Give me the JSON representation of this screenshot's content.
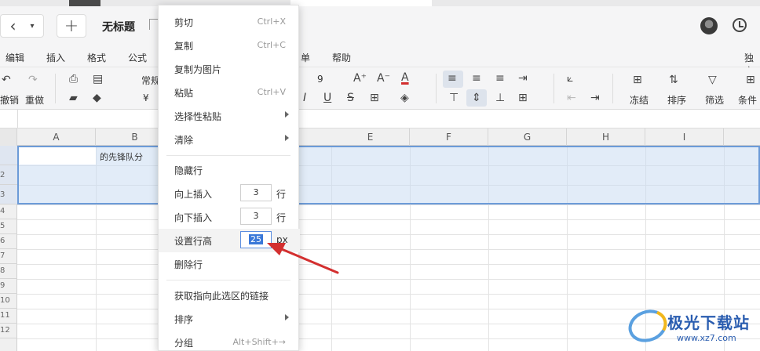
{
  "title_bar": {
    "doc_title": "无标题",
    "back_glyph": "‹",
    "dropdown_glyph": "▾",
    "add_glyph": "+"
  },
  "menu_bar": {
    "items": [
      "编辑",
      "插入",
      "格式",
      "公式",
      "单",
      "帮助"
    ],
    "right_item": "独立"
  },
  "toolbar": {
    "undo_label": "撤销",
    "redo_label": "重做",
    "number_format": "常规",
    "currency_glyph": "¥",
    "font_size": "9",
    "bold_glyph": "A⁺",
    "shrink_glyph": "A⁻",
    "font_color_glyph": "A",
    "italic_glyph": "I",
    "underline_glyph": "U",
    "strike_glyph": "S",
    "freeze_label": "冻结",
    "sort_label": "排序",
    "filter_label": "筛选",
    "conditional_label": "条件"
  },
  "grid": {
    "columns": [
      "A",
      "B",
      "E",
      "F",
      "G",
      "H",
      "I"
    ],
    "rows": [
      "",
      "2",
      "3",
      "4",
      "5",
      "6",
      "7",
      "8",
      "9",
      "10",
      "11",
      "12"
    ],
    "cell_b1": "的先锋队分"
  },
  "context_menu": {
    "items": [
      {
        "label": "剪切",
        "shortcut": "Ctrl+X"
      },
      {
        "label": "复制",
        "shortcut": "Ctrl+C"
      },
      {
        "label": "复制为图片",
        "shortcut": ""
      },
      {
        "label": "粘贴",
        "shortcut": "Ctrl+V"
      },
      {
        "label": "选择性粘贴",
        "shortcut": ""
      },
      {
        "label": "清除",
        "shortcut": ""
      },
      {
        "label": "隐藏行",
        "shortcut": ""
      },
      {
        "label": "向上插入",
        "value": "3",
        "unit": "行"
      },
      {
        "label": "向下插入",
        "value": "3",
        "unit": "行"
      },
      {
        "label": "设置行高",
        "value": "25",
        "unit": "px"
      },
      {
        "label": "删除行",
        "shortcut": ""
      },
      {
        "label": "获取指向此选区的链接",
        "shortcut": ""
      },
      {
        "label": "排序",
        "shortcut": ""
      },
      {
        "label": "分组",
        "shortcut": "Alt+Shift+→"
      }
    ]
  },
  "watermark": {
    "text": "极光下载站",
    "url": "www.xz7.com"
  },
  "colors": {
    "selection_border": "#6c9bd8",
    "selection_fill": "#cbdcf3",
    "arrow": "#d32f2f",
    "input_highlight": "#3a78d8"
  }
}
